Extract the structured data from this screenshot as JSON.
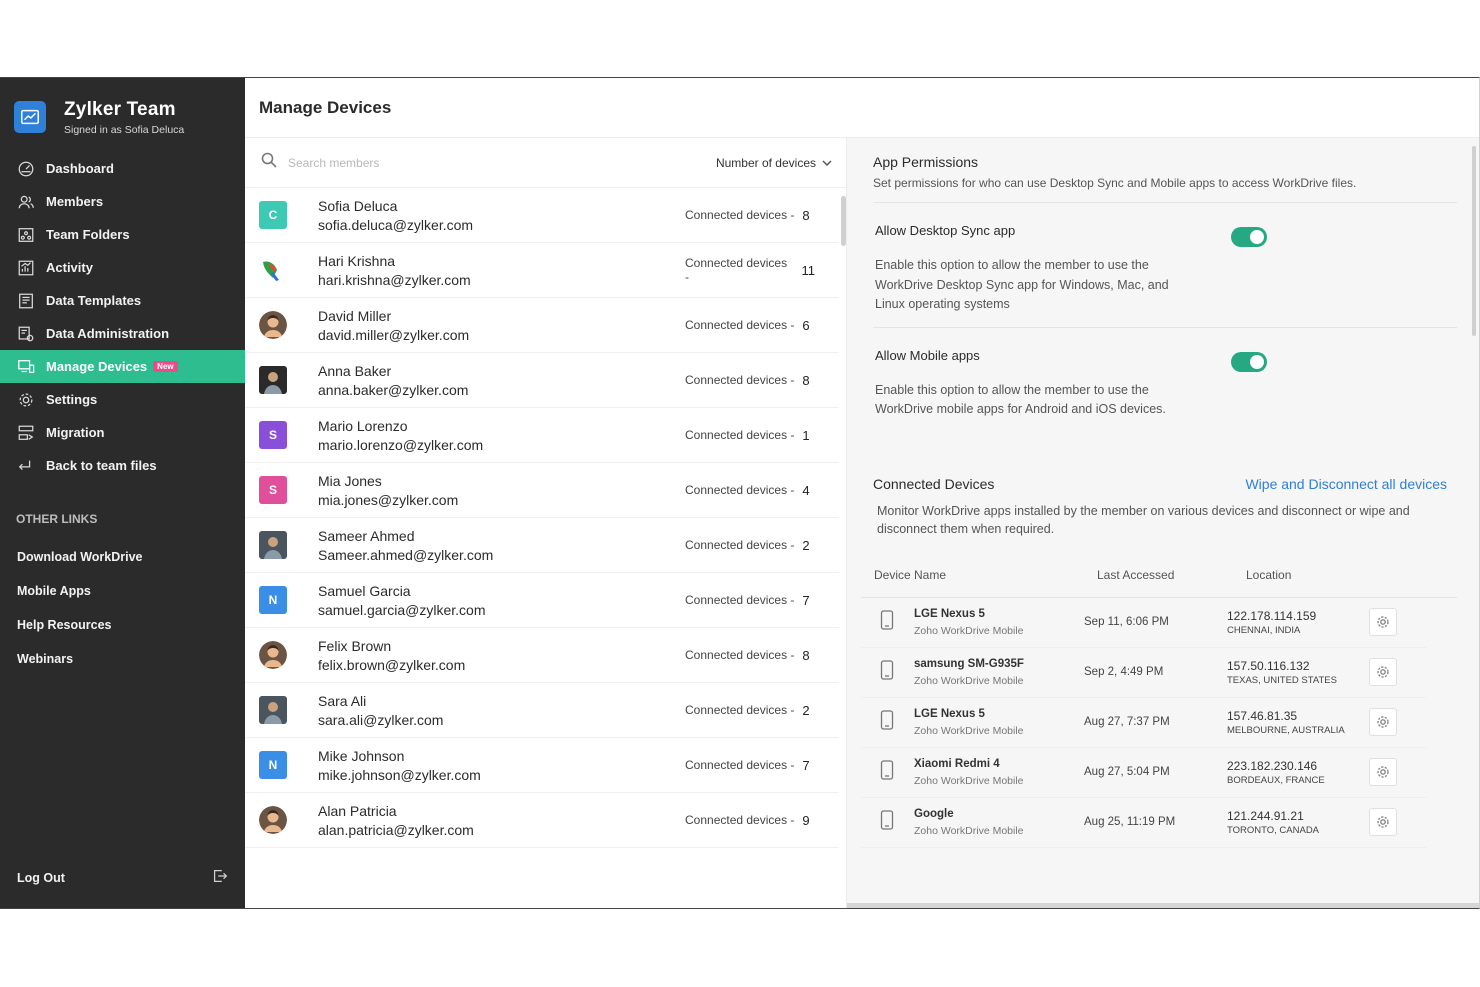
{
  "brand": {
    "title": "Zylker Team",
    "subtitle": "Signed in as Sofia Deluca"
  },
  "nav": [
    {
      "label": "Dashboard",
      "icon": "dashboard-icon"
    },
    {
      "label": "Members",
      "icon": "members-icon"
    },
    {
      "label": "Team Folders",
      "icon": "team-folders-icon"
    },
    {
      "label": "Activity",
      "icon": "activity-icon"
    },
    {
      "label": "Data Templates",
      "icon": "data-templates-icon"
    },
    {
      "label": "Data Administration",
      "icon": "data-administration-icon"
    },
    {
      "label": "Manage Devices",
      "icon": "manage-devices-icon",
      "badge": "New",
      "active": true
    },
    {
      "label": "Settings",
      "icon": "settings-icon"
    },
    {
      "label": "Migration",
      "icon": "migration-icon"
    },
    {
      "label": "Back to team files",
      "icon": "back-icon"
    }
  ],
  "other_links": {
    "title": "OTHER LINKS",
    "items": [
      "Download WorkDrive",
      "Mobile Apps",
      "Help Resources",
      "Webinars"
    ]
  },
  "logout": {
    "label": "Log Out"
  },
  "page": {
    "title": "Manage Devices"
  },
  "members_toolbar": {
    "search_placeholder": "Search members",
    "sort_label": "Number of devices"
  },
  "count_label": "Connected devices -",
  "members": [
    {
      "name": "Sofia Deluca",
      "email": "sofia.deluca@zylker.com",
      "count": "8",
      "initial": "C",
      "color": "#3ec9b4",
      "photo": false
    },
    {
      "name": "Hari Krishna",
      "email": "hari.krishna@zylker.com",
      "count": "11",
      "initial": "",
      "color": "#ffffff",
      "photo": "parrot"
    },
    {
      "name": "David Miller",
      "email": "david.miller@zylker.com",
      "count": "6",
      "initial": "",
      "color": "#5a4a3e",
      "photo": "round"
    },
    {
      "name": "Anna Baker",
      "email": "anna.baker@zylker.com",
      "count": "8",
      "initial": "",
      "color": "#2a2a2a",
      "photo": "square"
    },
    {
      "name": "Mario Lorenzo",
      "email": "mario.lorenzo@zylker.com",
      "count": "1",
      "initial": "S",
      "color": "#8a4fd8",
      "photo": false
    },
    {
      "name": "Mia Jones",
      "email": "mia.jones@zylker.com",
      "count": "4",
      "initial": "S",
      "color": "#e04f9a",
      "photo": false
    },
    {
      "name": "Sameer Ahmed",
      "email": "Sameer.ahmed@zylker.com",
      "count": "2",
      "initial": "",
      "color": "#4a5560",
      "photo": "square"
    },
    {
      "name": "Samuel Garcia",
      "email": "samuel.garcia@zylker.com",
      "count": "7",
      "initial": "N",
      "color": "#3a8ee6",
      "photo": false
    },
    {
      "name": "Felix Brown",
      "email": "felix.brown@zylker.com",
      "count": "8",
      "initial": "",
      "color": "#5a4a3e",
      "photo": "round"
    },
    {
      "name": "Sara Ali",
      "email": "sara.ali@zylker.com",
      "count": "2",
      "initial": "",
      "color": "#4a5560",
      "photo": "square"
    },
    {
      "name": "Mike Johnson",
      "email": "mike.johnson@zylker.com",
      "count": "7",
      "initial": "N",
      "color": "#3a8ee6",
      "photo": false
    },
    {
      "name": "Alan Patricia",
      "email": "alan.patricia@zylker.com",
      "count": "9",
      "initial": "",
      "color": "#5a4a3e",
      "photo": "round"
    }
  ],
  "permissions": {
    "title": "App Permissions",
    "description": "Set permissions for who can use Desktop Sync and Mobile apps to access WorkDrive files.",
    "items": [
      {
        "title": "Allow Desktop Sync app",
        "description": "Enable this option to allow the member to use the WorkDrive Desktop Sync app for Windows, Mac, and Linux operating systems",
        "enabled": true
      },
      {
        "title": "Allow Mobile apps",
        "description": "Enable this option to allow the member to use the WorkDrive mobile apps for Android and iOS devices.",
        "enabled": true
      }
    ]
  },
  "connected_devices": {
    "title": "Connected Devices",
    "wipe_link": "Wipe and Disconnect all devices",
    "description": "Monitor WorkDrive apps installed by the member on various devices and disconnect or wipe and disconnect them when required.",
    "columns": [
      "Device Name",
      "Last Accessed",
      "Location"
    ],
    "rows": [
      {
        "name": "LGE Nexus 5",
        "app": "Zoho WorkDrive Mobile",
        "last": "Sep 11, 6:06 PM",
        "ip": "122.178.114.159",
        "place": "CHENNAI, INDIA"
      },
      {
        "name": "samsung SM-G935F",
        "app": "Zoho WorkDrive Mobile",
        "last": "Sep 2, 4:49 PM",
        "ip": "157.50.116.132",
        "place": "TEXAS, UNITED STATES"
      },
      {
        "name": "LGE Nexus 5",
        "app": "Zoho WorkDrive Mobile",
        "last": "Aug 27, 7:37 PM",
        "ip": "157.46.81.35",
        "place": "MELBOURNE, AUSTRALIA"
      },
      {
        "name": "Xiaomi Redmi 4",
        "app": "Zoho WorkDrive Mobile",
        "last": "Aug 27, 5:04 PM",
        "ip": "223.182.230.146",
        "place": "BORDEAUX, FRANCE"
      },
      {
        "name": "Google",
        "app": "Zoho WorkDrive Mobile",
        "last": "Aug 25, 11:19 PM",
        "ip": "121.244.91.21",
        "place": "TORONTO, CANADA"
      }
    ]
  }
}
